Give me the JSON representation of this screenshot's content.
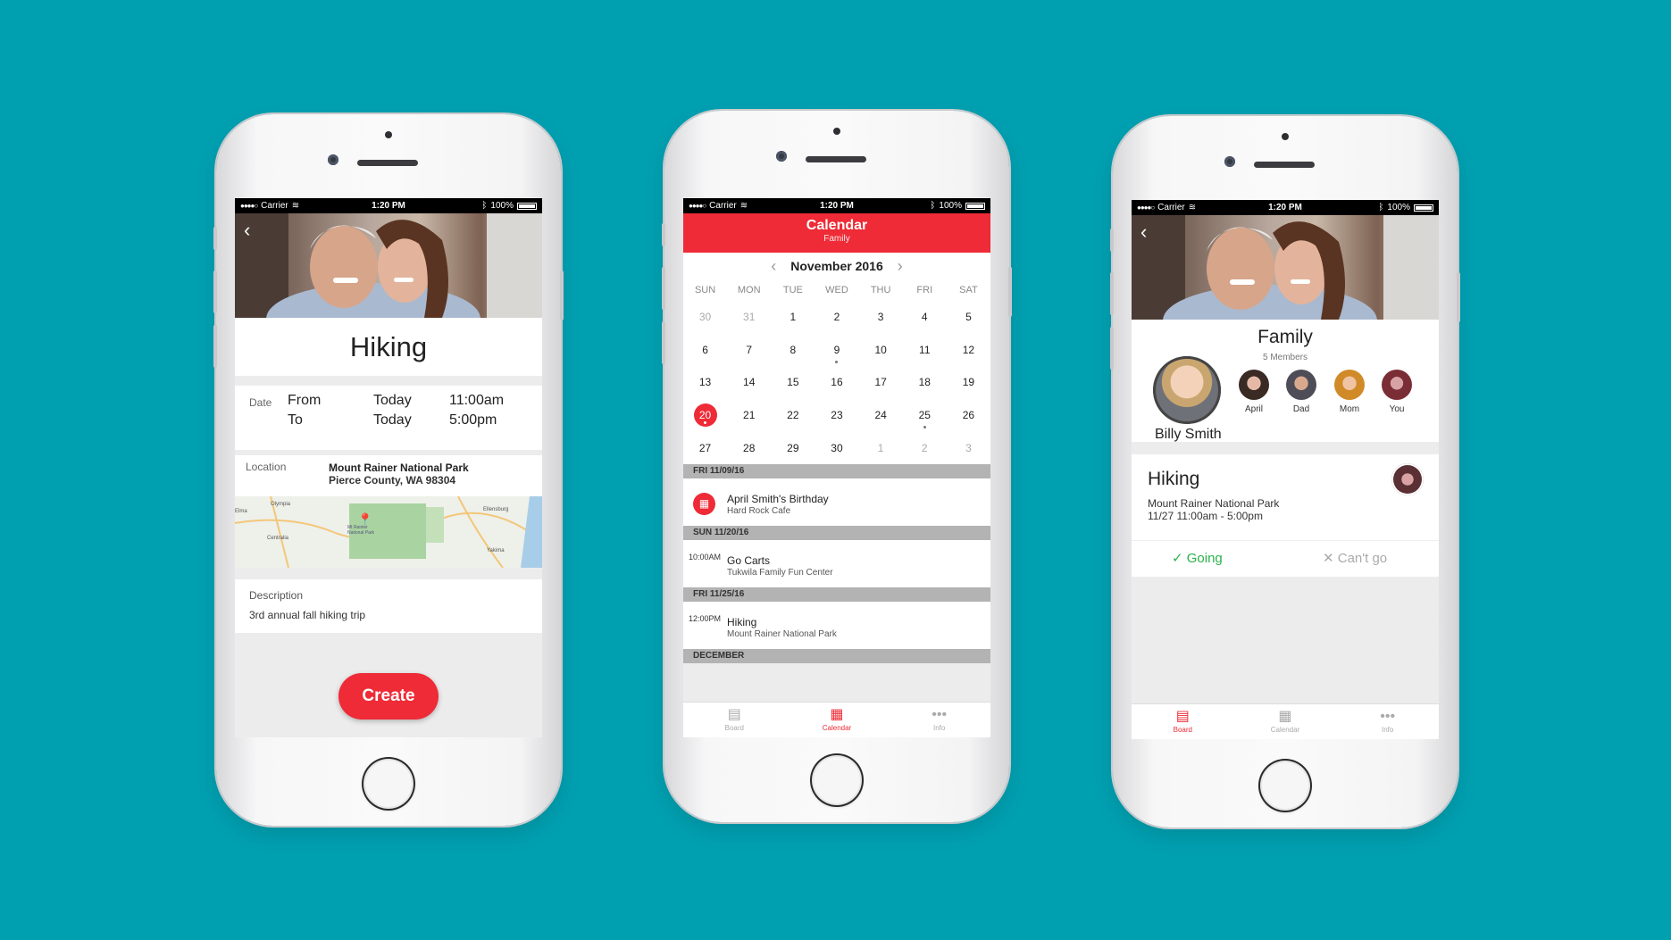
{
  "colors": {
    "background": "#00a0b1",
    "accent": "#ee2b36",
    "going": "#2bb24c"
  },
  "status_bar": {
    "carrier": "Carrier",
    "time": "1:20 PM",
    "battery": "100%"
  },
  "create_screen": {
    "title": "Hiking",
    "date_label": "Date",
    "from_label": "From",
    "from_day": "Today",
    "from_time": "11:00am",
    "to_label": "To",
    "to_day": "Today",
    "to_time": "5:00pm",
    "location_label": "Location",
    "location_name": "Mount Rainer National Park",
    "location_address": "Pierce County, WA 98304",
    "map_labels": {
      "olympia": "Olympia",
      "park": "Mt Rainier National Park",
      "ellensburg": "Ellensburg",
      "centralia": "Centralia",
      "yakima": "Yakima",
      "elma": "Elma"
    },
    "description_label": "Description",
    "description_value": "3rd annual fall hiking trip",
    "create_button": "Create"
  },
  "calendar_screen": {
    "header_title": "Calendar",
    "header_subtitle": "Family",
    "month": "November 2016",
    "weekdays": [
      "SUN",
      "MON",
      "TUE",
      "WED",
      "THU",
      "FRI",
      "SAT"
    ],
    "days": [
      {
        "n": "30",
        "muted": true
      },
      {
        "n": "31",
        "muted": true
      },
      {
        "n": "1"
      },
      {
        "n": "2"
      },
      {
        "n": "3"
      },
      {
        "n": "4"
      },
      {
        "n": "5"
      },
      {
        "n": "6"
      },
      {
        "n": "7"
      },
      {
        "n": "8"
      },
      {
        "n": "9",
        "dot": true
      },
      {
        "n": "10"
      },
      {
        "n": "11"
      },
      {
        "n": "12"
      },
      {
        "n": "13"
      },
      {
        "n": "14"
      },
      {
        "n": "15"
      },
      {
        "n": "16"
      },
      {
        "n": "17"
      },
      {
        "n": "18"
      },
      {
        "n": "19"
      },
      {
        "n": "20",
        "today": true,
        "dot": true
      },
      {
        "n": "21"
      },
      {
        "n": "22"
      },
      {
        "n": "23"
      },
      {
        "n": "24"
      },
      {
        "n": "25",
        "dot": true
      },
      {
        "n": "26"
      },
      {
        "n": "27"
      },
      {
        "n": "28"
      },
      {
        "n": "29"
      },
      {
        "n": "30"
      },
      {
        "n": "1",
        "muted": true
      },
      {
        "n": "2",
        "muted": true
      },
      {
        "n": "3",
        "muted": true
      }
    ],
    "sections": [
      {
        "header": "FRI 11/09/16",
        "icon": "birthday-cake-icon",
        "time": "",
        "title": "April Smith's Birthday",
        "subtitle": "Hard Rock Cafe"
      },
      {
        "header": "SUN 11/20/16",
        "icon": "",
        "time": "10:00AM",
        "title": "Go Carts",
        "subtitle": "Tukwila Family Fun Center"
      },
      {
        "header": "FRI 11/25/16",
        "icon": "",
        "time": "12:00PM",
        "title": "Hiking",
        "subtitle": "Mount Rainer National Park"
      },
      {
        "header": "DECEMBER",
        "icon": "",
        "time": "",
        "title": "",
        "subtitle": ""
      }
    ]
  },
  "tabs": {
    "board": "Board",
    "calendar": "Calendar",
    "info": "Info"
  },
  "board_screen": {
    "group_name": "Family",
    "members_count": "5 Members",
    "featured_member": "Billy Smith",
    "members": [
      "April",
      "Dad",
      "Mom",
      "You"
    ],
    "event_title": "Hiking",
    "event_location": "Mount Rainer National Park",
    "event_time": "11/27 11:00am - 5:00pm",
    "going_label": "Going",
    "cant_label": "Can't go"
  }
}
